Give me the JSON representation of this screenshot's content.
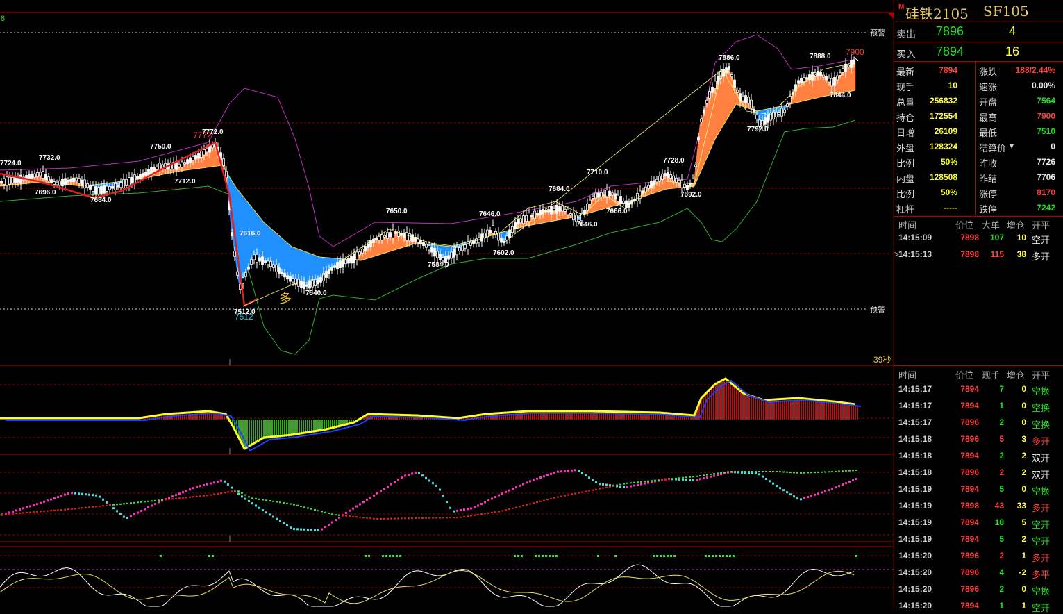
{
  "colors": {
    "up": "#ff4040",
    "down": "#20e020",
    "yellow": "#ffff40",
    "frame": "#b00000",
    "white": "#e8e8e8"
  },
  "chart": {
    "left_tick": "8",
    "alert_label_top": "预警",
    "alert_label_bottom": "预警",
    "countdown": "39秒",
    "current_price_label": "7900",
    "high_red_label": "7772",
    "low_cyan_label": "7512",
    "lots_marker": "多",
    "price_labels": [
      "7724.0",
      "7732.0",
      "7696.0",
      "7684.0",
      "7750.0",
      "7772.0",
      "7712.0",
      "7616.0",
      "7512.0",
      "7540.0",
      "7650.0",
      "7584.0",
      "7646.0",
      "7602.0",
      "7684.0",
      "7646.0",
      "7710.0",
      "7666.0",
      "7728.0",
      "7692.0",
      "7886.0",
      "7792.0",
      "7888.0",
      "7844.0"
    ]
  },
  "panel": {
    "marker": "M",
    "name": "硅铁2105",
    "code": "SF105",
    "sell": {
      "label": "卖出",
      "price": "7896",
      "volume": "4"
    },
    "buy": {
      "label": "买入",
      "price": "7894",
      "volume": "16"
    },
    "stats_left": [
      {
        "label": "最新",
        "value": "7894",
        "color": "#ff4040"
      },
      {
        "label": "现手",
        "value": "10",
        "color": "#ffff40"
      },
      {
        "label": "总量",
        "value": "256832",
        "color": "#ffff40"
      },
      {
        "label": "持仓",
        "value": "172554",
        "color": "#ffff40"
      },
      {
        "label": "日增",
        "value": "26109",
        "color": "#ffff40"
      },
      {
        "label": "外盘",
        "value": "128324",
        "color": "#ffff40"
      },
      {
        "label": "比例",
        "value": "50%",
        "color": "#ffff40"
      },
      {
        "label": "内盘",
        "value": "128508",
        "color": "#ffff40"
      },
      {
        "label": "比例",
        "value": "50%",
        "color": "#ffff40"
      },
      {
        "label": "杠杆",
        "value": "-----",
        "color": "#ffff40"
      }
    ],
    "stats_right": [
      {
        "label": "涨跌",
        "value": "188/2.44%",
        "color": "#ff4040"
      },
      {
        "label": "速涨",
        "value": "0.00%",
        "color": "#e8e8e8"
      },
      {
        "label": "开盘",
        "value": "7564",
        "color": "#20e020"
      },
      {
        "label": "最高",
        "value": "7900",
        "color": "#ff4040"
      },
      {
        "label": "最低",
        "value": "7510",
        "color": "#20e020"
      },
      {
        "label": "结算价",
        "value": "0",
        "color": "#e8e8e8"
      },
      {
        "label": "昨收",
        "value": "7726",
        "color": "#e8e8e8"
      },
      {
        "label": "昨结",
        "value": "7706",
        "color": "#e8e8e8"
      },
      {
        "label": "涨停",
        "value": "8170",
        "color": "#ff4040"
      },
      {
        "label": "跌停",
        "value": "7242",
        "color": "#20e020"
      }
    ],
    "big_header": {
      "time": "时间",
      "price": "价位",
      "big": "大单",
      "chg": "增仓",
      "oc": "开平"
    },
    "big_rows": [
      {
        "time": "14:15:09",
        "price": "7898",
        "amt": "107",
        "chg": "10",
        "type": "空开",
        "amt_color": "#20e020",
        "type_color": "#e8e8e8",
        "mark": ""
      },
      {
        "time": "14:15:13",
        "price": "7898",
        "amt": "115",
        "chg": "38",
        "type": "多开",
        "amt_color": "#ff4040",
        "type_color": "#e8e8e8",
        "mark": ">"
      }
    ],
    "tick_header": {
      "time": "时间",
      "price": "价位",
      "qty": "现手",
      "chg": "增仓",
      "oc": "开平"
    },
    "tick_rows": [
      {
        "time": "14:15:17",
        "price": "7894",
        "qty": "7",
        "chg": "0",
        "type": "空换",
        "qty_color": "#20e020",
        "type_color": "#20e020"
      },
      {
        "time": "14:15:17",
        "price": "7894",
        "qty": "1",
        "chg": "0",
        "type": "空换",
        "qty_color": "#20e020",
        "type_color": "#20e020"
      },
      {
        "time": "14:15:17",
        "price": "7896",
        "qty": "2",
        "chg": "0",
        "type": "空换",
        "qty_color": "#20e020",
        "type_color": "#20e020"
      },
      {
        "time": "14:15:18",
        "price": "7896",
        "qty": "5",
        "chg": "3",
        "type": "多开",
        "qty_color": "#ff4040",
        "type_color": "#ff4040"
      },
      {
        "time": "14:15:18",
        "price": "7894",
        "qty": "2",
        "chg": "2",
        "type": "双开",
        "qty_color": "#20e020",
        "type_color": "#e8e8e8"
      },
      {
        "time": "14:15:18",
        "price": "7896",
        "qty": "2",
        "chg": "2",
        "type": "双开",
        "qty_color": "#ff4040",
        "type_color": "#e8e8e8"
      },
      {
        "time": "14:15:19",
        "price": "7894",
        "qty": "5",
        "chg": "0",
        "type": "空换",
        "qty_color": "#20e020",
        "type_color": "#20e020"
      },
      {
        "time": "14:15:19",
        "price": "7898",
        "qty": "43",
        "chg": "33",
        "type": "多开",
        "qty_color": "#ff4040",
        "type_color": "#ff4040"
      },
      {
        "time": "14:15:19",
        "price": "7894",
        "qty": "18",
        "chg": "5",
        "type": "空开",
        "qty_color": "#20e020",
        "type_color": "#20e020"
      },
      {
        "time": "14:15:19",
        "price": "7894",
        "qty": "5",
        "chg": "2",
        "type": "空开",
        "qty_color": "#20e020",
        "type_color": "#20e020"
      },
      {
        "time": "14:15:20",
        "price": "7896",
        "qty": "2",
        "chg": "1",
        "type": "多开",
        "qty_color": "#ff4040",
        "type_color": "#ff4040"
      },
      {
        "time": "14:15:20",
        "price": "7896",
        "qty": "4",
        "chg": "-2",
        "type": "多平",
        "qty_color": "#20e020",
        "type_color": "#ff4040"
      },
      {
        "time": "14:15:20",
        "price": "7896",
        "qty": "2",
        "chg": "0",
        "type": "空换",
        "qty_color": "#20e020",
        "type_color": "#20e020"
      },
      {
        "time": "14:15:20",
        "price": "7894",
        "qty": "1",
        "chg": "1",
        "type": "空开",
        "qty_color": "#20e020",
        "type_color": "#20e020"
      }
    ]
  }
}
